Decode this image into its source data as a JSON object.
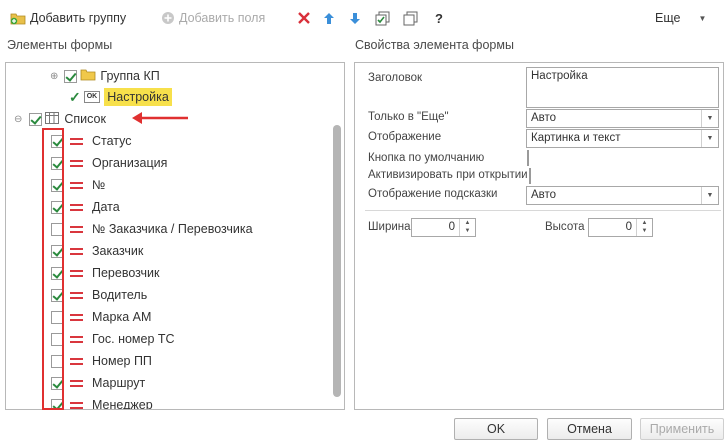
{
  "toolbar": {
    "add_group_label": "Добавить группу",
    "add_fields_label": "Добавить поля",
    "more_label": "Еще",
    "help_label": "?"
  },
  "left_title": "Элементы формы",
  "right_title": "Свойства элемента формы",
  "tree": {
    "group_label": "Группа КП",
    "command_label": "Настройка",
    "command_badge": "OK",
    "list_label": "Список",
    "fields": [
      {
        "label": "Статус",
        "checked": true
      },
      {
        "label": "Организация",
        "checked": true
      },
      {
        "label": "№",
        "checked": true
      },
      {
        "label": "Дата",
        "checked": true
      },
      {
        "label": "№ Заказчика / Перевозчика",
        "checked": false
      },
      {
        "label": "Заказчик",
        "checked": true
      },
      {
        "label": "Перевозчик",
        "checked": true
      },
      {
        "label": "Водитель",
        "checked": true
      },
      {
        "label": "Марка АМ",
        "checked": false
      },
      {
        "label": "Гос. номер ТС",
        "checked": false
      },
      {
        "label": "Номер ПП",
        "checked": false
      },
      {
        "label": "Маршрут",
        "checked": true
      },
      {
        "label": "Менеджер",
        "checked": true
      }
    ]
  },
  "props": {
    "title_label": "Заголовок",
    "title_value": "Настройка",
    "only_in_more_label": "Только в \"Еще\"",
    "only_in_more_value": "Авто",
    "display_label": "Отображение",
    "display_value": "Картинка и текст",
    "default_button_label": "Кнопка по умолчанию",
    "activate_on_open_label": "Активизировать при открытии",
    "tooltip_display_label": "Отображение подсказки",
    "tooltip_display_value": "Авто",
    "width_label": "Ширина",
    "width_value": "0",
    "height_label": "Высота",
    "height_value": "0"
  },
  "footer": {
    "ok_label": "OK",
    "cancel_label": "Отмена",
    "apply_label": "Применить"
  },
  "colors": {
    "highlight": "#f7e04b",
    "annotation": "#e03030",
    "check": "#2b8a3e"
  }
}
